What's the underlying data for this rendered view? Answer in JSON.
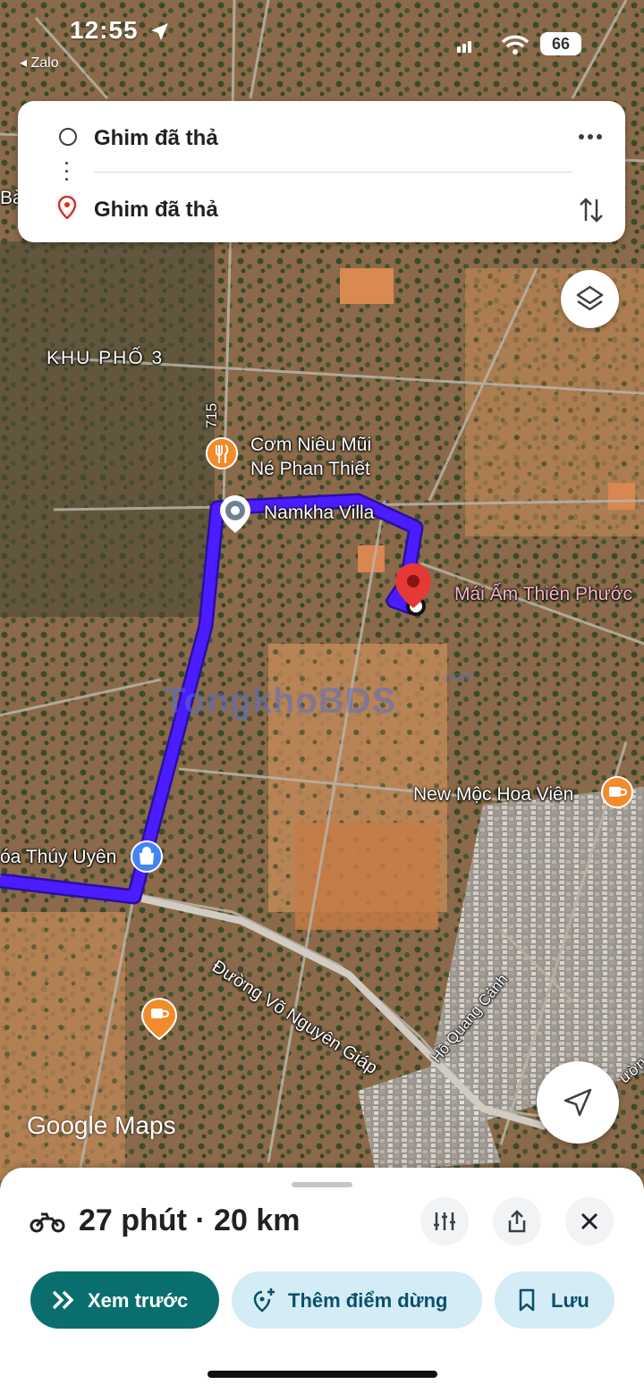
{
  "status_bar": {
    "time": "12:55",
    "back_app": "Zalo",
    "battery": "66"
  },
  "route_card": {
    "origin_label": "Ghim đã thả",
    "destination_label": "Ghim đã thả"
  },
  "map": {
    "labels": {
      "area_bau": "Bà",
      "khu_pho": "KHU PHỐ 3",
      "road_715": "715",
      "restaurant": "Cơm Niêu Mũi\nNé Phan Thiết",
      "villa": "Namkha Villa",
      "destination_place": "Mái Ấm Thiên Phước",
      "cafe": "New Mộc Hoa Viên",
      "shop": "óa Thúy Uyên",
      "road_vo_nguyen_giap": "Đường Võ Nguyên Giáp",
      "road_ho_quang_canh": "Hồ Quang Cảnh",
      "road_edge": "ườn"
    },
    "watermark": "TongkhoBDS",
    "watermark_small": ".com",
    "google_logo": "Google Maps",
    "route_color": "#4b1cff"
  },
  "bottom_sheet": {
    "duration": "27 phút · 20 km",
    "preview_button": "Xem trước",
    "add_stop_button": "Thêm điểm dừng",
    "save_button": "Lưu"
  },
  "colors": {
    "accent_teal": "#0b6e6e",
    "pin_red": "#e53935"
  }
}
